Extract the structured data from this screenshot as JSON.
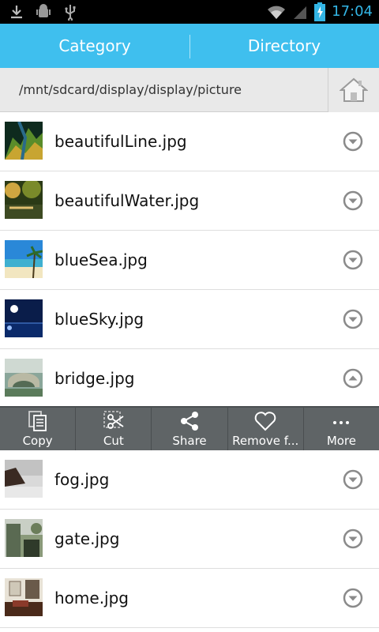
{
  "statusbar": {
    "time": "17:04",
    "icons": [
      "download-icon",
      "android-debug-icon",
      "usb-icon",
      "wifi-icon",
      "signal-icon",
      "battery-charging-icon"
    ]
  },
  "tabs": {
    "category_label": "Category",
    "directory_label": "Directory",
    "active": "Directory"
  },
  "pathbar": {
    "path": "/mnt/sdcard/display/display/picture",
    "home_icon": "home-icon"
  },
  "files_top": [
    {
      "name": "beautifulLine.jpg",
      "expanded": false
    },
    {
      "name": "beautifulWater.jpg",
      "expanded": false
    },
    {
      "name": "blueSea.jpg",
      "expanded": false
    },
    {
      "name": "blueSky.jpg",
      "expanded": false
    },
    {
      "name": "bridge.jpg",
      "expanded": true
    }
  ],
  "actions": [
    {
      "label": "Copy",
      "icon": "copy-icon"
    },
    {
      "label": "Cut",
      "icon": "scissors-icon"
    },
    {
      "label": "Share",
      "icon": "share-icon"
    },
    {
      "label": "Remove f...",
      "icon": "heart-icon"
    },
    {
      "label": "More",
      "icon": "more-icon"
    }
  ],
  "files_bottom": [
    {
      "name": "fog.jpg",
      "expanded": false
    },
    {
      "name": "gate.jpg",
      "expanded": false
    },
    {
      "name": "home.jpg",
      "expanded": false
    }
  ],
  "colors": {
    "tab_bar": "#3fbfee",
    "clock": "#33b5e5",
    "action_bar": "#5f6466"
  }
}
